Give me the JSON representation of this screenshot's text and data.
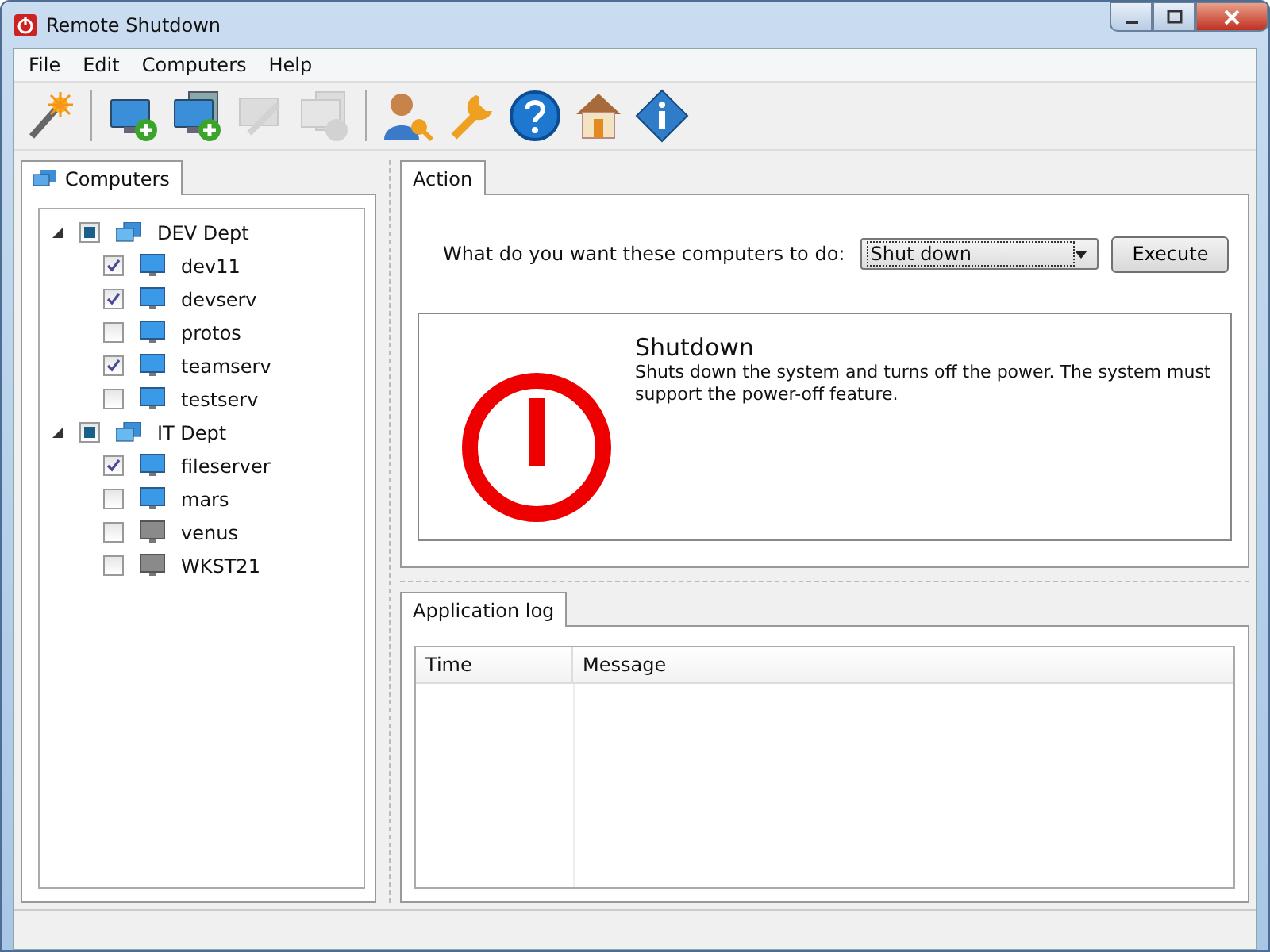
{
  "window": {
    "title": "Remote Shutdown"
  },
  "menu": [
    "File",
    "Edit",
    "Computers",
    "Help"
  ],
  "toolbar": [
    {
      "kind": "wand",
      "disabled": false
    },
    {
      "kind": "sep"
    },
    {
      "kind": "add",
      "disabled": false
    },
    {
      "kind": "add2",
      "disabled": false
    },
    {
      "kind": "edit",
      "disabled": true
    },
    {
      "kind": "remove",
      "disabled": true
    },
    {
      "kind": "sep"
    },
    {
      "kind": "userkey",
      "disabled": false
    },
    {
      "kind": "wrench",
      "disabled": false
    },
    {
      "kind": "help",
      "disabled": false
    },
    {
      "kind": "home",
      "disabled": false
    },
    {
      "kind": "info",
      "disabled": false
    }
  ],
  "left_tab": {
    "label": "Computers",
    "selected": true
  },
  "tree": [
    {
      "label": "DEV Dept",
      "expanded": true,
      "partial": true,
      "children": [
        {
          "label": "dev11",
          "checked": true,
          "online": true
        },
        {
          "label": "devserv",
          "checked": true,
          "online": true
        },
        {
          "label": "protos",
          "checked": false,
          "online": true
        },
        {
          "label": "teamserv",
          "checked": true,
          "online": true
        },
        {
          "label": "testserv",
          "checked": false,
          "online": true
        }
      ]
    },
    {
      "label": "IT Dept",
      "expanded": true,
      "partial": true,
      "children": [
        {
          "label": "fileserver",
          "checked": true,
          "online": true
        },
        {
          "label": "mars",
          "checked": false,
          "online": true
        },
        {
          "label": "venus",
          "checked": false,
          "online": false
        },
        {
          "label": "WKST21",
          "checked": false,
          "online": false
        }
      ]
    }
  ],
  "action": {
    "tab": {
      "label": "Action",
      "selected": true
    },
    "prompt": "What do you want these computers to do:",
    "dropdown": "Shut down",
    "button": "Execute",
    "title": "Shutdown",
    "description": "Shuts down the system and turns off the power. The system must support the power-off feature."
  },
  "log": {
    "tab": {
      "label": "Application log",
      "selected": true
    },
    "columns": [
      "Time",
      "Message"
    ]
  }
}
